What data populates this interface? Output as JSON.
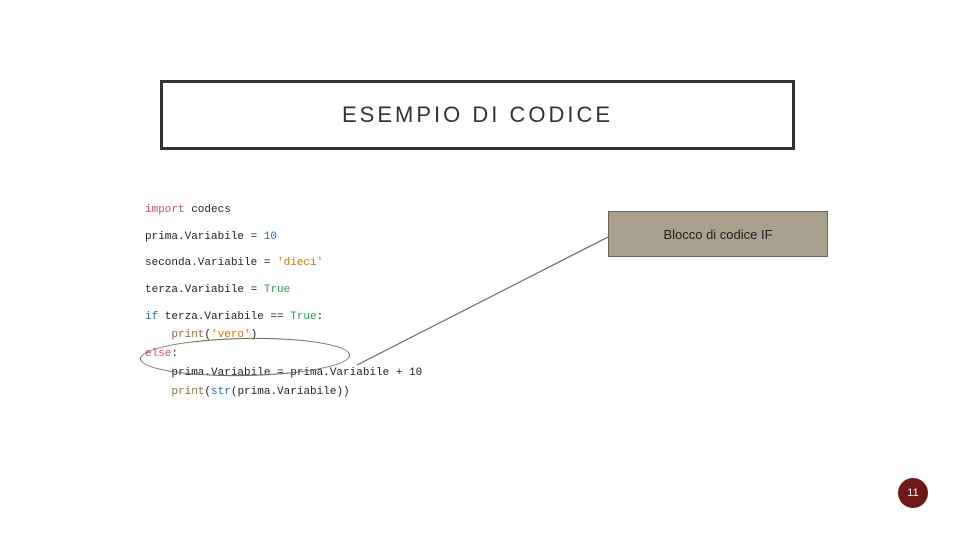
{
  "title": "ESEMPIO DI CODICE",
  "annotation": "Blocco di codice IF",
  "page_number": "11",
  "code": {
    "l1a": "import",
    "l1b": " codecs",
    "l2a": "prima.Variabile = ",
    "l2b": "10",
    "l3a": "seconda.Variabile = ",
    "l3b": "'dieci'",
    "l4a": "terza.Variabile = ",
    "l4b": "True",
    "l5a": "if",
    "l5b": " terza.Variabile == ",
    "l5c": "True",
    "l5d": ":",
    "l6a": "    ",
    "l6b": "print",
    "l6c": "(",
    "l6d": "'vero'",
    "l6e": ")",
    "l7a": "else",
    "l7b": ":",
    "l8": "    prima.Variabile = prima.Variabile + 10",
    "l9a": "    ",
    "l9b": "print",
    "l9c": "(",
    "l9d": "str",
    "l9e": "(prima.Variabile))"
  }
}
